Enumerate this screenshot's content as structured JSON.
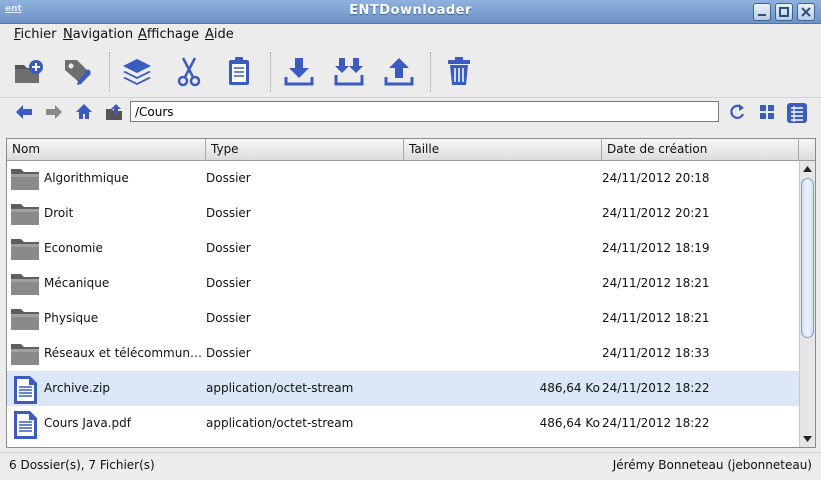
{
  "window": {
    "title": "ENTDownloader",
    "logo_text": "ent"
  },
  "menu": {
    "items": [
      "Fichier",
      "Navigation",
      "Affichage",
      "Aide"
    ]
  },
  "toolbar": {
    "icons": [
      "new-folder-icon",
      "tag-edit-icon",
      "layers-icon",
      "cut-icon",
      "clipboard-icon",
      "download-icon",
      "download-all-icon",
      "upload-icon",
      "trash-icon"
    ]
  },
  "navigation": {
    "path": "/Cours"
  },
  "table": {
    "columns": [
      "Nom",
      "Type",
      "Taille",
      "Date de création"
    ],
    "rows": [
      {
        "name": "Algorithmique",
        "type": "Dossier",
        "size": "",
        "date": "24/11/2012 20:18",
        "kind": "folder"
      },
      {
        "name": "Droit",
        "type": "Dossier",
        "size": "",
        "date": "24/11/2012 20:21",
        "kind": "folder"
      },
      {
        "name": "Economie",
        "type": "Dossier",
        "size": "",
        "date": "24/11/2012 18:19",
        "kind": "folder"
      },
      {
        "name": "Mécanique",
        "type": "Dossier",
        "size": "",
        "date": "24/11/2012 18:21",
        "kind": "folder"
      },
      {
        "name": "Physique",
        "type": "Dossier",
        "size": "",
        "date": "24/11/2012 18:21",
        "kind": "folder"
      },
      {
        "name": "Réseaux et télécommunic...",
        "type": "Dossier",
        "size": "",
        "date": "24/11/2012 18:33",
        "kind": "folder"
      },
      {
        "name": "Archive.zip",
        "type": "application/octet-stream",
        "size": "486,64 Ko",
        "date": "24/11/2012 18:22",
        "kind": "file",
        "selected": true
      },
      {
        "name": "Cours Java.pdf",
        "type": "application/octet-stream",
        "size": "486,64 Ko",
        "date": "24/11/2012 18:22",
        "kind": "file"
      }
    ]
  },
  "status": {
    "summary": "6 Dossier(s), 7 Fichier(s)",
    "user": "Jérémy Bonneteau (jebonneteau)"
  },
  "colors": {
    "accent": "#3b5bbf",
    "title_bar": "#7aa0d2",
    "selection": "#dbe7f6"
  }
}
